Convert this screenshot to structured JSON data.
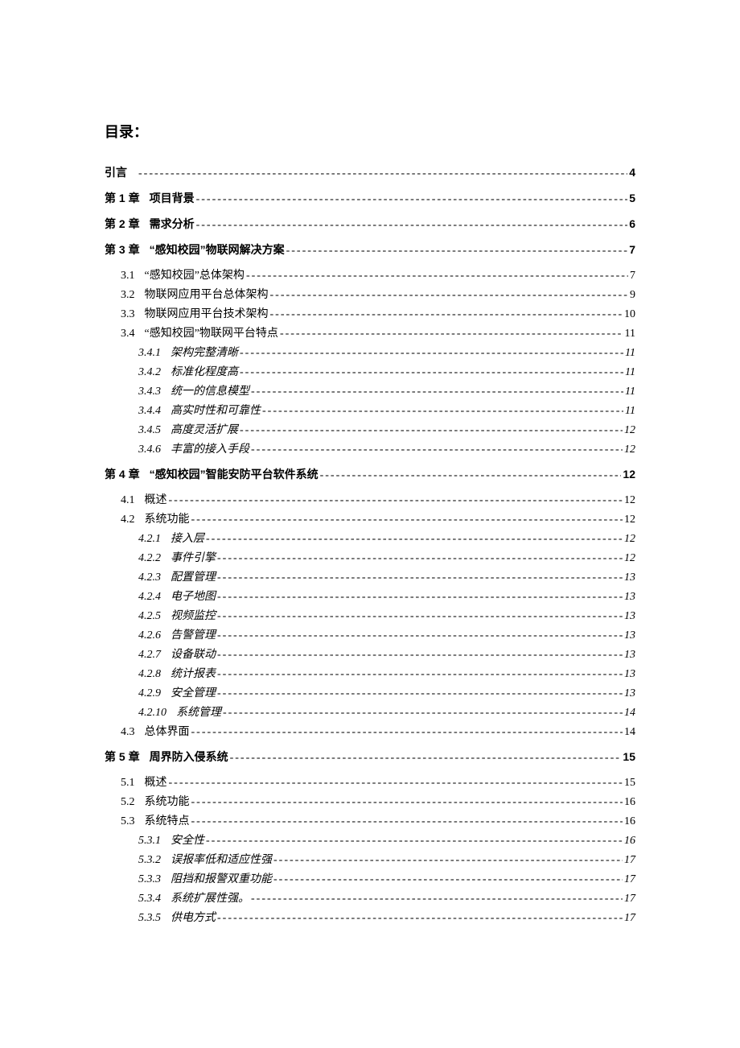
{
  "title": "目录：",
  "entries": [
    {
      "level": 0,
      "num": "引言",
      "label": "",
      "page": "4",
      "first": true,
      "nonum": true
    },
    {
      "level": 0,
      "num": "第 1 章",
      "label": "项目背景",
      "page": "5"
    },
    {
      "level": 0,
      "num": "第 2 章",
      "label": "需求分析",
      "page": "6"
    },
    {
      "level": 0,
      "num": "第 3 章",
      "label": "“感知校园”物联网解决方案",
      "page": "7"
    },
    {
      "level": 1,
      "num": "3.1",
      "label": "“感知校园”总体架构",
      "page": "7"
    },
    {
      "level": 1,
      "num": "3.2",
      "label": "物联网应用平台总体架构",
      "page": "9"
    },
    {
      "level": 1,
      "num": "3.3",
      "label": "物联网应用平台技术架构",
      "page": "10"
    },
    {
      "level": 1,
      "num": "3.4",
      "label": "“感知校园”物联网平台特点",
      "page": "11"
    },
    {
      "level": 2,
      "num": "3.4.1",
      "label": "架构完整清晰",
      "page": "11"
    },
    {
      "level": 2,
      "num": "3.4.2",
      "label": "标准化程度高",
      "page": "11"
    },
    {
      "level": 2,
      "num": "3.4.3",
      "label": "统一的信息模型",
      "page": "11"
    },
    {
      "level": 2,
      "num": "3.4.4",
      "label": "高实时性和可靠性",
      "page": "11"
    },
    {
      "level": 2,
      "num": "3.4.5",
      "label": "高度灵活扩展",
      "page": "12"
    },
    {
      "level": 2,
      "num": "3.4.6",
      "label": "丰富的接入手段",
      "page": "12"
    },
    {
      "level": 0,
      "num": "第 4 章",
      "label": "“感知校园”智能安防平台软件系统",
      "page": "12"
    },
    {
      "level": 1,
      "num": "4.1",
      "label": "概述",
      "page": "12"
    },
    {
      "level": 1,
      "num": "4.2",
      "label": "系统功能",
      "page": "12"
    },
    {
      "level": 2,
      "num": "4.2.1",
      "label": "接入层",
      "page": "12"
    },
    {
      "level": 2,
      "num": "4.2.2",
      "label": "事件引擎",
      "page": "12"
    },
    {
      "level": 2,
      "num": "4.2.3",
      "label": "配置管理",
      "page": "13"
    },
    {
      "level": 2,
      "num": "4.2.4",
      "label": "电子地图",
      "page": "13"
    },
    {
      "level": 2,
      "num": "4.2.5",
      "label": "视频监控",
      "page": "13"
    },
    {
      "level": 2,
      "num": "4.2.6",
      "label": "告警管理",
      "page": "13"
    },
    {
      "level": 2,
      "num": "4.2.7",
      "label": "设备联动",
      "page": "13"
    },
    {
      "level": 2,
      "num": "4.2.8",
      "label": "统计报表",
      "page": "13"
    },
    {
      "level": 2,
      "num": "4.2.9",
      "label": "安全管理",
      "page": "13"
    },
    {
      "level": 2,
      "num": "4.2.10",
      "label": "系统管理",
      "page": "14"
    },
    {
      "level": 1,
      "num": "4.3",
      "label": "总体界面",
      "page": "14"
    },
    {
      "level": 0,
      "num": "第 5 章",
      "label": "周界防入侵系统",
      "page": "15"
    },
    {
      "level": 1,
      "num": "5.1",
      "label": "概述",
      "page": "15"
    },
    {
      "level": 1,
      "num": "5.2",
      "label": "系统功能",
      "page": "16"
    },
    {
      "level": 1,
      "num": "5.3",
      "label": "系统特点",
      "page": "16"
    },
    {
      "level": 2,
      "num": "5.3.1",
      "label": "安全性",
      "page": "16"
    },
    {
      "level": 2,
      "num": "5.3.2",
      "label": "误报率低和适应性强",
      "page": "17"
    },
    {
      "level": 2,
      "num": "5.3.3",
      "label": "阻挡和报警双重功能",
      "page": "17"
    },
    {
      "level": 2,
      "num": "5.3.4",
      "label": "系统扩展性强。",
      "page": "17"
    },
    {
      "level": 2,
      "num": "5.3.5",
      "label": "供电方式",
      "page": "17"
    }
  ]
}
